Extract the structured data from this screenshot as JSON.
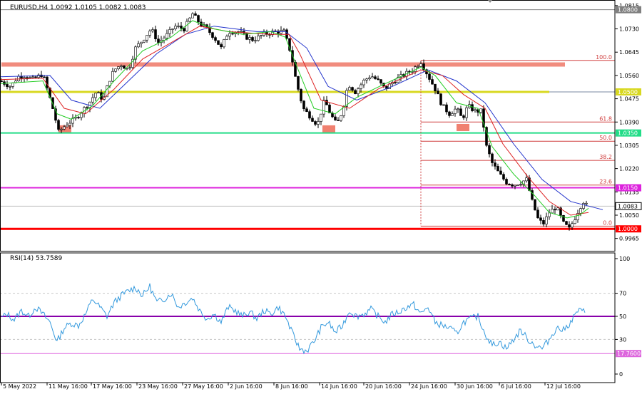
{
  "header": {
    "symbol_line": "EURUSD,H4  1.0092 1.0105 1.0082 1.0083",
    "rsi_label": "RSI(14) 53.7589"
  },
  "colors": {
    "bull_candle": "#000000",
    "bear_candle": "#000000",
    "ma_fast": "#22cc22",
    "ma_mid": "#dd2222",
    "ma_slow": "#2233cc",
    "rsi_line": "#3399dd",
    "level_1_0800": "#808080",
    "level_1_0500": "#d8d820",
    "level_1_0350": "#22dd88",
    "level_1_0150": "#dd22dd",
    "level_1_0000": "#ff0000",
    "resistance_zone": "#f08070",
    "fib": "#d04040",
    "rsi_50": "#8800aa",
    "rsi_17": "#dd66dd"
  },
  "chart_data": [
    {
      "type": "candlestick",
      "title": "EURUSD,H4",
      "ylim": [
        0.992,
        1.0825
      ],
      "y_ticks": [
        "1.0815",
        "1.0730",
        "1.0645",
        "1.0560",
        "1.0475",
        "1.0390",
        "1.0305",
        "1.0220",
        "1.0135",
        "1.0050",
        "0.9965"
      ],
      "x_ticks": [
        "5 May 2022",
        "11 May 16:00",
        "17 May 16:00",
        "23 May 16:00",
        "27 May 16:00",
        "2 Jun 16:00",
        "8 Jun 16:00",
        "14 Jun 16:00",
        "20 Jun 16:00",
        "24 Jun 16:00",
        "30 Jun 16:00",
        "6 Jul 16:00",
        "12 Jul 16:00"
      ],
      "close_path": [
        [
          0,
          1.054
        ],
        [
          15,
          1.052
        ],
        [
          25,
          1.0555
        ],
        [
          35,
          1.056
        ],
        [
          45,
          1.0545
        ],
        [
          60,
          1.0565
        ],
        [
          68,
          1.0495
        ],
        [
          75,
          1.043
        ],
        [
          82,
          1.0355
        ],
        [
          95,
          1.0385
        ],
        [
          105,
          1.04
        ],
        [
          115,
          1.043
        ],
        [
          125,
          1.046
        ],
        [
          135,
          1.05
        ],
        [
          145,
          1.047
        ],
        [
          152,
          1.0535
        ],
        [
          160,
          1.058
        ],
        [
          170,
          1.06
        ],
        [
          180,
          1.058
        ],
        [
          190,
          1.066
        ],
        [
          200,
          1.069
        ],
        [
          212,
          1.073
        ],
        [
          222,
          1.068
        ],
        [
          235,
          1.071
        ],
        [
          245,
          1.074
        ],
        [
          258,
          1.073
        ],
        [
          270,
          1.0785
        ],
        [
          280,
          1.075
        ],
        [
          290,
          1.073
        ],
        [
          300,
          1.07
        ],
        [
          310,
          1.066
        ],
        [
          320,
          1.072
        ],
        [
          335,
          1.072
        ],
        [
          345,
          1.07
        ],
        [
          355,
          1.069
        ],
        [
          370,
          1.071
        ],
        [
          385,
          1.072
        ],
        [
          398,
          1.072
        ],
        [
          408,
          1.064
        ],
        [
          415,
          1.054
        ],
        [
          425,
          1.044
        ],
        [
          435,
          1.041
        ],
        [
          445,
          1.038
        ],
        [
          455,
          1.047
        ],
        [
          463,
          1.042
        ],
        [
          472,
          1.038
        ],
        [
          480,
          1.043
        ],
        [
          488,
          1.053
        ],
        [
          498,
          1.05
        ],
        [
          510,
          1.054
        ],
        [
          520,
          1.056
        ],
        [
          530,
          1.054
        ],
        [
          540,
          1.051
        ],
        [
          552,
          1.054
        ],
        [
          565,
          1.056
        ],
        [
          578,
          1.058
        ],
        [
          590,
          1.061
        ],
        [
          600,
          1.056
        ],
        [
          610,
          1.051
        ],
        [
          620,
          1.045
        ],
        [
          630,
          1.042
        ],
        [
          640,
          1.044
        ],
        [
          648,
          1.04
        ],
        [
          656,
          1.045
        ],
        [
          665,
          1.043
        ],
        [
          675,
          1.043
        ],
        [
          682,
          1.03
        ],
        [
          690,
          1.024
        ],
        [
          700,
          1.02
        ],
        [
          710,
          1.017
        ],
        [
          720,
          1.016
        ],
        [
          730,
          1.017
        ],
        [
          738,
          1.018
        ],
        [
          746,
          1.01
        ],
        [
          755,
          1.003
        ],
        [
          762,
          1.002
        ],
        [
          770,
          1.006
        ],
        [
          780,
          1.008
        ],
        [
          790,
          1.002
        ],
        [
          798,
          1.0
        ],
        [
          806,
          1.004
        ],
        [
          812,
          1.0075
        ],
        [
          818,
          1.01
        ],
        [
          823,
          1.0083
        ]
      ],
      "ma_fast_path": [
        [
          0,
          1.053
        ],
        [
          60,
          1.054
        ],
        [
          80,
          1.042
        ],
        [
          100,
          1.04
        ],
        [
          130,
          1.045
        ],
        [
          160,
          1.054
        ],
        [
          200,
          1.065
        ],
        [
          240,
          1.07
        ],
        [
          270,
          1.076
        ],
        [
          300,
          1.073
        ],
        [
          340,
          1.071
        ],
        [
          380,
          1.072
        ],
        [
          400,
          1.07
        ],
        [
          415,
          1.06
        ],
        [
          440,
          1.044
        ],
        [
          470,
          1.042
        ],
        [
          500,
          1.048
        ],
        [
          540,
          1.053
        ],
        [
          590,
          1.059
        ],
        [
          610,
          1.056
        ],
        [
          640,
          1.046
        ],
        [
          670,
          1.044
        ],
        [
          690,
          1.03
        ],
        [
          720,
          1.02
        ],
        [
          750,
          1.012
        ],
        [
          770,
          1.006
        ],
        [
          795,
          1.004
        ],
        [
          812,
          1.005
        ],
        [
          825,
          1.0075
        ]
      ],
      "ma_mid_path": [
        [
          0,
          1.0545
        ],
        [
          60,
          1.055
        ],
        [
          90,
          1.044
        ],
        [
          120,
          1.042
        ],
        [
          160,
          1.051
        ],
        [
          200,
          1.062
        ],
        [
          240,
          1.068
        ],
        [
          280,
          1.074
        ],
        [
          320,
          1.072
        ],
        [
          380,
          1.071
        ],
        [
          405,
          1.071
        ],
        [
          420,
          1.064
        ],
        [
          450,
          1.047
        ],
        [
          490,
          1.044
        ],
        [
          530,
          1.051
        ],
        [
          590,
          1.058
        ],
        [
          620,
          1.056
        ],
        [
          650,
          1.049
        ],
        [
          680,
          1.044
        ],
        [
          705,
          1.031
        ],
        [
          740,
          1.019
        ],
        [
          770,
          1.01
        ],
        [
          800,
          1.005
        ],
        [
          825,
          1.006
        ]
      ],
      "ma_slow_path": [
        [
          0,
          1.0555
        ],
        [
          70,
          1.056
        ],
        [
          100,
          1.047
        ],
        [
          140,
          1.044
        ],
        [
          180,
          1.054
        ],
        [
          220,
          1.064
        ],
        [
          260,
          1.071
        ],
        [
          300,
          1.074
        ],
        [
          360,
          1.072
        ],
        [
          400,
          1.072
        ],
        [
          430,
          1.066
        ],
        [
          460,
          1.052
        ],
        [
          500,
          1.047
        ],
        [
          550,
          1.052
        ],
        [
          600,
          1.058
        ],
        [
          640,
          1.054
        ],
        [
          680,
          1.046
        ],
        [
          720,
          1.031
        ],
        [
          760,
          1.018
        ],
        [
          800,
          1.01
        ],
        [
          845,
          1.007
        ]
      ],
      "horizontal_levels": [
        {
          "label": "1.0800",
          "value": 1.08,
          "color": "#808080"
        },
        {
          "label": "1.0500",
          "value": 1.05,
          "color": "#d8d820"
        },
        {
          "label": "1.0350",
          "value": 1.035,
          "color": "#22dd88"
        },
        {
          "label": "1.0150",
          "value": 1.015,
          "color": "#dd22dd"
        },
        {
          "label": "1.0000",
          "value": 1.0,
          "color": "#ff0000"
        }
      ],
      "current_price": {
        "label": "1.0083",
        "value": 1.0083
      },
      "fibonacci": [
        {
          "label": "100.0",
          "value": 1.0615
        },
        {
          "label": "61.8",
          "value": 1.039
        },
        {
          "label": "50.0",
          "value": 1.032
        },
        {
          "label": "38.2",
          "value": 1.025
        },
        {
          "label": "23.6",
          "value": 1.016
        },
        {
          "label": "0.0",
          "value": 1.001
        }
      ],
      "resistance_zone": {
        "value": 1.06
      }
    },
    {
      "type": "line",
      "title": "RSI(14) 53.7589",
      "ylim": [
        0,
        100
      ],
      "y_ticks": [
        "100",
        "70",
        "50",
        "30",
        "0"
      ],
      "levels": [
        {
          "label": "50",
          "value": 50,
          "color": "#8800aa"
        },
        {
          "label": "17.7600",
          "value": 17.76,
          "color": "#dd66dd"
        }
      ],
      "rsi_path": [
        [
          0,
          48
        ],
        [
          10,
          52
        ],
        [
          20,
          47
        ],
        [
          30,
          55
        ],
        [
          40,
          50
        ],
        [
          50,
          58
        ],
        [
          60,
          52
        ],
        [
          70,
          45
        ],
        [
          80,
          28
        ],
        [
          90,
          40
        ],
        [
          100,
          44
        ],
        [
          110,
          42
        ],
        [
          120,
          52
        ],
        [
          130,
          65
        ],
        [
          140,
          58
        ],
        [
          150,
          50
        ],
        [
          160,
          62
        ],
        [
          170,
          68
        ],
        [
          180,
          72
        ],
        [
          190,
          75
        ],
        [
          200,
          68
        ],
        [
          210,
          76
        ],
        [
          220,
          62
        ],
        [
          230,
          65
        ],
        [
          240,
          70
        ],
        [
          250,
          58
        ],
        [
          260,
          62
        ],
        [
          270,
          66
        ],
        [
          280,
          55
        ],
        [
          290,
          48
        ],
        [
          300,
          52
        ],
        [
          310,
          45
        ],
        [
          320,
          58
        ],
        [
          330,
          55
        ],
        [
          340,
          50
        ],
        [
          350,
          54
        ],
        [
          360,
          48
        ],
        [
          370,
          55
        ],
        [
          380,
          52
        ],
        [
          390,
          58
        ],
        [
          400,
          50
        ],
        [
          410,
          35
        ],
        [
          420,
          22
        ],
        [
          430,
          20
        ],
        [
          440,
          28
        ],
        [
          450,
          40
        ],
        [
          460,
          45
        ],
        [
          470,
          36
        ],
        [
          480,
          42
        ],
        [
          490,
          55
        ],
        [
          500,
          50
        ],
        [
          510,
          52
        ],
        [
          520,
          56
        ],
        [
          530,
          50
        ],
        [
          540,
          45
        ],
        [
          550,
          52
        ],
        [
          560,
          54
        ],
        [
          570,
          58
        ],
        [
          580,
          60
        ],
        [
          590,
          52
        ],
        [
          600,
          58
        ],
        [
          610,
          45
        ],
        [
          620,
          42
        ],
        [
          630,
          40
        ],
        [
          640,
          35
        ],
        [
          650,
          45
        ],
        [
          660,
          48
        ],
        [
          670,
          50
        ],
        [
          680,
          35
        ],
        [
          690,
          25
        ],
        [
          700,
          28
        ],
        [
          710,
          22
        ],
        [
          720,
          30
        ],
        [
          730,
          38
        ],
        [
          740,
          30
        ],
        [
          750,
          25
        ],
        [
          760,
          22
        ],
        [
          770,
          30
        ],
        [
          780,
          40
        ],
        [
          790,
          38
        ],
        [
          800,
          45
        ],
        [
          810,
          55
        ],
        [
          820,
          54
        ]
      ]
    }
  ]
}
